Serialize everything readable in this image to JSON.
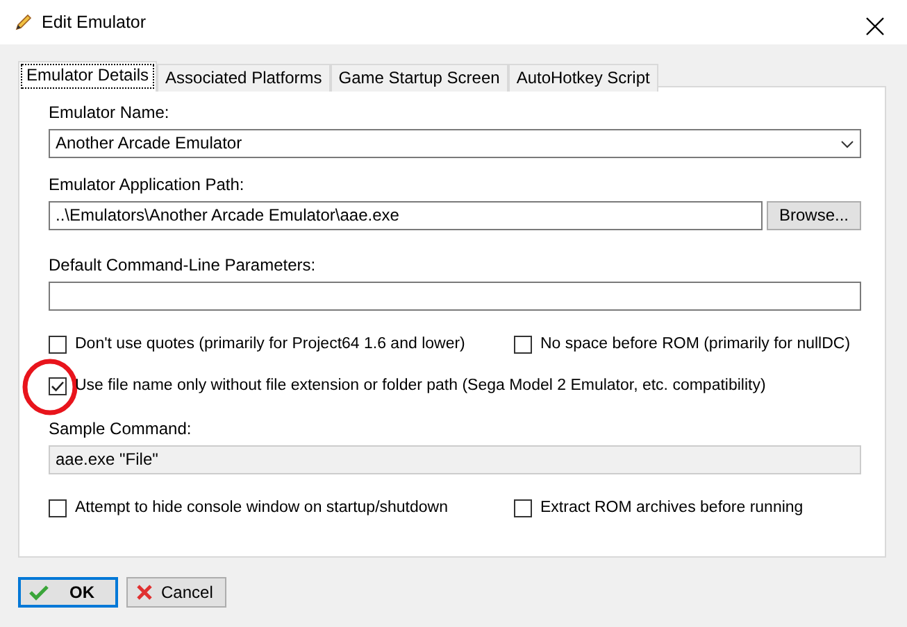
{
  "window": {
    "title": "Edit Emulator"
  },
  "tabs": [
    {
      "label": "Emulator Details",
      "selected": true
    },
    {
      "label": "Associated Platforms",
      "selected": false
    },
    {
      "label": "Game Startup Screen",
      "selected": false
    },
    {
      "label": "AutoHotkey Script",
      "selected": false
    }
  ],
  "emulator_name": {
    "label": "Emulator Name:",
    "value": "Another Arcade Emulator"
  },
  "application_path": {
    "label": "Emulator Application Path:",
    "value": "..\\Emulators\\Another Arcade Emulator\\aae.exe",
    "button": "Browse..."
  },
  "parameters": {
    "label": "Default Command-Line Parameters:"
  },
  "option_rows": [
    [
      {
        "label": "Don't use quotes (primarily for Project64 1.6 and lower)",
        "checked": false
      },
      {
        "label": "No space before ROM (primarily for nullDC)",
        "checked": false
      }
    ],
    [
      {
        "label": "Use file name only without file extension or folder path (Sega Model 2 Emulator, etc. compatibility)",
        "checked": true,
        "annotated": true
      }
    ]
  ],
  "sample_command": {
    "label": "Sample Command:",
    "value": "aae.exe \"File\""
  },
  "bottom_options": [
    {
      "label": "Attempt to hide console window on startup/shutdown",
      "checked": false
    },
    {
      "label": "Extract ROM archives before running",
      "checked": false
    }
  ],
  "buttons": [
    {
      "label": "OK",
      "kind": "ok",
      "default": true
    },
    {
      "label": "Cancel",
      "kind": "cancel",
      "default": false
    }
  ]
}
